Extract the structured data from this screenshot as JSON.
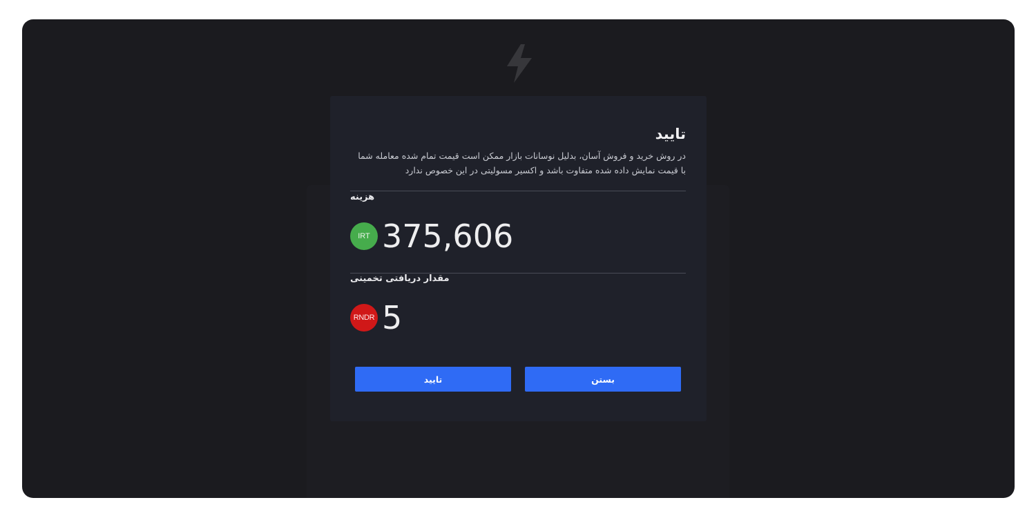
{
  "modal": {
    "title": "تایید",
    "description": "در روش خرید و فروش آسان، بدلیل نوسانات بازار ممکن است قیمت تمام شده معامله شما با قیمت نمایش داده شده متفاوت باشد و اکسیر مسولیتی در این خصوص ندارد",
    "cost": {
      "label": "هزینه",
      "currency": "IRT",
      "currency_color": "#46ac4c",
      "amount": "375,606"
    },
    "estimated_receive": {
      "label": "مقدار دریافتی تخمینی",
      "currency": "RNDR",
      "currency_color": "#d01818",
      "amount": "5"
    },
    "buttons": {
      "confirm_label": "تایید",
      "close_label": "بستن",
      "color": "#2f6bf5"
    }
  },
  "background": {
    "logo_icon": "lightning-bolt-icon"
  }
}
